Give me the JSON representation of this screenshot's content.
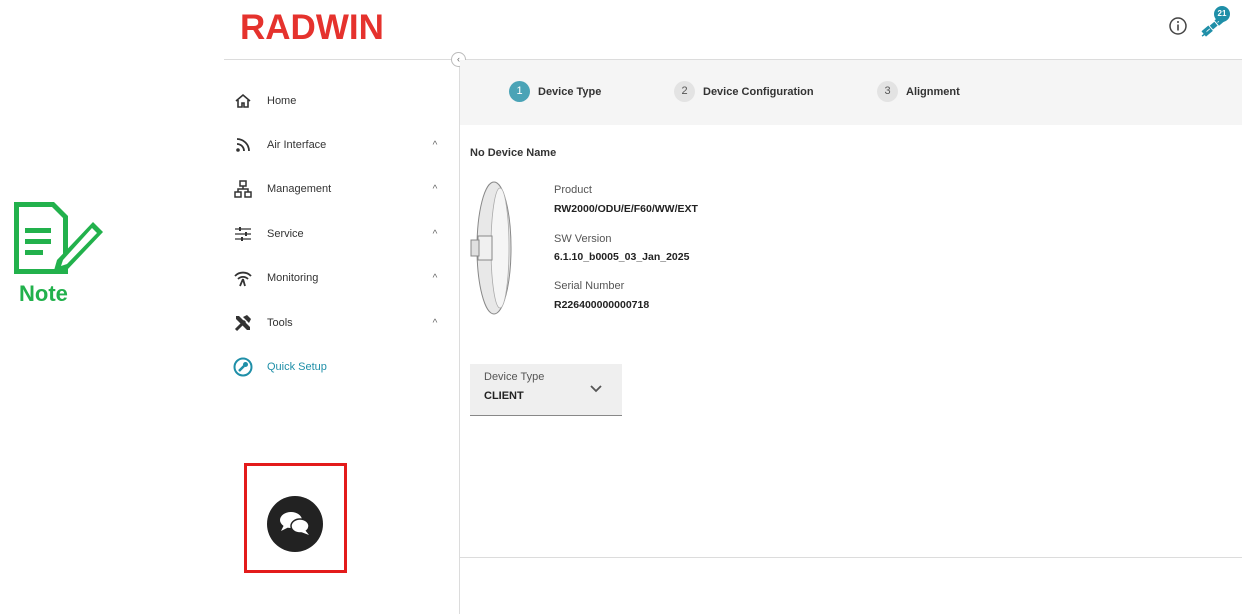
{
  "note_badge": {
    "label": "Note",
    "icon": "note-edit-icon",
    "color": "#22b14c"
  },
  "header": {
    "logo_text": "RADWIN",
    "logo_color": "#e5322d",
    "info_icon": "info-icon",
    "satellite_icon": "satellite-icon",
    "satellite_badge_count": "21"
  },
  "sidebar": {
    "collapse_icon": "chevron-left-icon",
    "items": [
      {
        "label": "Home",
        "icon": "home-icon",
        "expandable": false
      },
      {
        "label": "Air Interface",
        "icon": "wireless-icon",
        "expandable": true
      },
      {
        "label": "Management",
        "icon": "network-icon",
        "expandable": true
      },
      {
        "label": "Service",
        "icon": "sliders-icon",
        "expandable": true
      },
      {
        "label": "Monitoring",
        "icon": "signal-icon",
        "expandable": true
      },
      {
        "label": "Tools",
        "icon": "tools-icon",
        "expandable": true
      },
      {
        "label": "Quick Setup",
        "icon": "quick-setup-icon",
        "expandable": false,
        "active": true
      }
    ],
    "chat_icon": "chat-icon"
  },
  "stepper": {
    "steps": [
      {
        "number": "1",
        "label": "Device Type",
        "active": true
      },
      {
        "number": "2",
        "label": "Device Configuration",
        "active": false
      },
      {
        "number": "3",
        "label": "Alignment",
        "active": false
      }
    ],
    "accent": "#4aa3b6"
  },
  "device": {
    "name": "No Device Name",
    "product_label": "Product",
    "product_value": "RW2000/ODU/E/F60/WW/EXT",
    "sw_label": "SW Version",
    "sw_value": "6.1.10_b0005_03_Jan_2025",
    "serial_label": "Serial Number",
    "serial_value": "R226400000000718"
  },
  "device_type_select": {
    "label": "Device Type",
    "value": "CLIENT"
  }
}
